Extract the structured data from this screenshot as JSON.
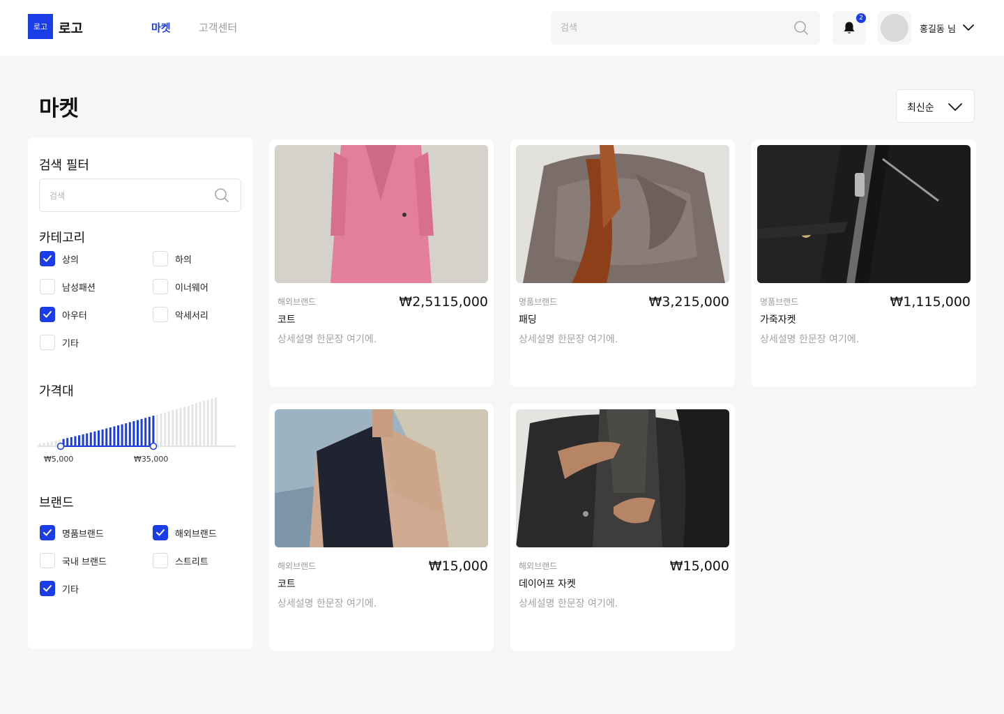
{
  "header": {
    "logo_mark": "로고",
    "logo_text": "로고",
    "nav": [
      {
        "label": "마켓",
        "active": true
      },
      {
        "label": "고객센터",
        "active": false
      }
    ],
    "search_placeholder": "검색",
    "notification_count": "2",
    "username": "홍길동 님"
  },
  "page": {
    "title": "마켓",
    "sort_label": "최신순"
  },
  "filter": {
    "title": "검색 필터",
    "search_placeholder": "검색",
    "category_title": "카테고리",
    "categories": [
      {
        "label": "상의",
        "checked": true
      },
      {
        "label": "하의",
        "checked": false
      },
      {
        "label": "남성패션",
        "checked": false
      },
      {
        "label": "이너웨어",
        "checked": false
      },
      {
        "label": "아우터",
        "checked": true
      },
      {
        "label": "악세서리",
        "checked": false
      },
      {
        "label": "기타",
        "checked": false
      }
    ],
    "price_title": "가격대",
    "price_min": "₩5,000",
    "price_max": "₩35,000",
    "brand_title": "브랜드",
    "brands": [
      {
        "label": "명품브랜드",
        "checked": true
      },
      {
        "label": "해외브랜드",
        "checked": true
      },
      {
        "label": "국내 브랜드",
        "checked": false
      },
      {
        "label": "스트리트",
        "checked": false
      },
      {
        "label": "기타",
        "checked": true
      }
    ]
  },
  "products": [
    {
      "brand": "해외브랜드",
      "price": "₩2,5115,000",
      "name": "코트",
      "desc": "상세설명 한문장 여기에."
    },
    {
      "brand": "명품브랜드",
      "price": "₩3,215,000",
      "name": "패딩",
      "desc": "상세설명 한문장 여기에."
    },
    {
      "brand": "명품브랜드",
      "price": "₩1,115,000",
      "name": "가죽자켓",
      "desc": "상세설명 한문장 여기에."
    },
    {
      "brand": "해외브랜드",
      "price": "₩15,000",
      "name": "코트",
      "desc": "상세설명 한문장 여기에."
    },
    {
      "brand": "해외브랜드",
      "price": "₩15,000",
      "name": "데이어프 자켓",
      "desc": "상세설명 한문장 여기에."
    }
  ],
  "colors": {
    "accent": "#1a3de8",
    "muted": "#9a9a9a",
    "bar_inactive": "#e4e4e4"
  }
}
